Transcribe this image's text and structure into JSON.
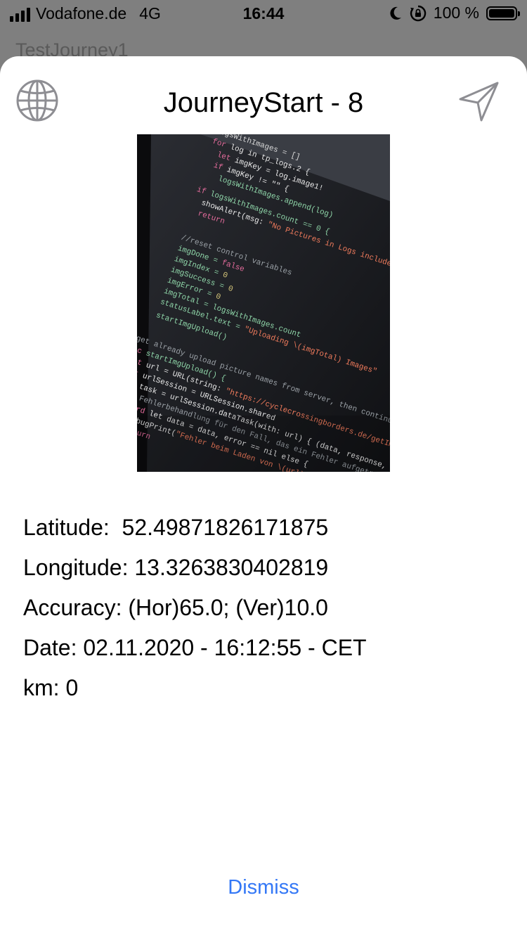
{
  "status_bar": {
    "carrier": "Vodafone.de",
    "network": "4G",
    "time": "16:44",
    "battery": "100 %",
    "icons": [
      "signal-bars-icon",
      "moon-icon",
      "rotation-lock-icon",
      "battery-icon"
    ]
  },
  "background_title": "TestJourney1",
  "sheet": {
    "title": "JourneyStart - 8",
    "left_icon": "globe-icon",
    "right_icon": "send-icon",
    "photo": "photo of code editor screen",
    "info": {
      "latitude": "Latitude:  52.49871826171875",
      "longitude": "Longitude: 13.3263830402819",
      "accuracy": "Accuracy: (Hor)65.0; (Ver)10.0",
      "date": "Date: 02.11.2020 - 16:12:55 - CET",
      "km": "km: 0"
    },
    "dismiss_label": "Dismiss"
  },
  "colors": {
    "accent": "#3478f6",
    "overlay": "#7f7f7f",
    "icon_gray": "#8e8e93"
  }
}
